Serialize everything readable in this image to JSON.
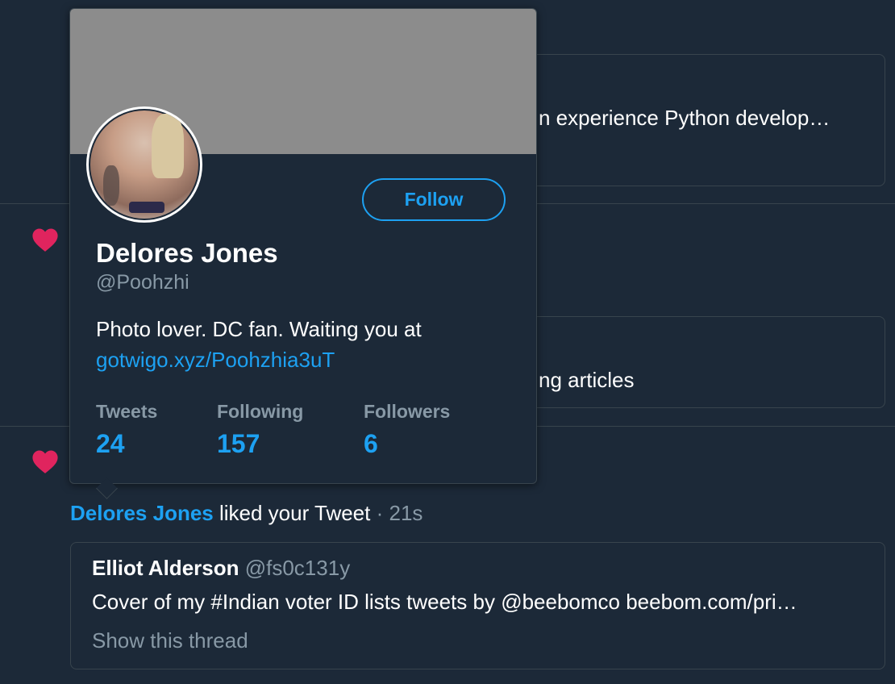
{
  "background_tweets": {
    "tweet1_text": "n experience Python develop…",
    "tweet2_text": "ng articles"
  },
  "notification": {
    "liker_name": "Delores Jones",
    "action_text": " liked your Tweet",
    "time_text": " · 21s",
    "tweet": {
      "author": "Elliot Alderson",
      "handle": "@fs0c131y",
      "text": "Cover of my #Indian voter ID lists tweets by @beebomco beebom.com/pri…",
      "thread_link": "Show this thread"
    }
  },
  "hovercard": {
    "name": "Delores Jones",
    "handle": "@Poohzhi",
    "bio_text": "Photo lover. DC fan. Waiting you at",
    "bio_link": "gotwigo.xyz/Poohzhia3uT",
    "follow_label": "Follow",
    "stats": [
      {
        "label": "Tweets",
        "value": "24"
      },
      {
        "label": "Following",
        "value": "157"
      },
      {
        "label": "Followers",
        "value": "6"
      }
    ]
  },
  "icons": {
    "like_heart": "heart-icon"
  },
  "colors": {
    "background": "#1c2938",
    "accent": "#1da1f2",
    "heart": "#e0245e",
    "muted": "#8899a6",
    "border": "#38444d"
  }
}
